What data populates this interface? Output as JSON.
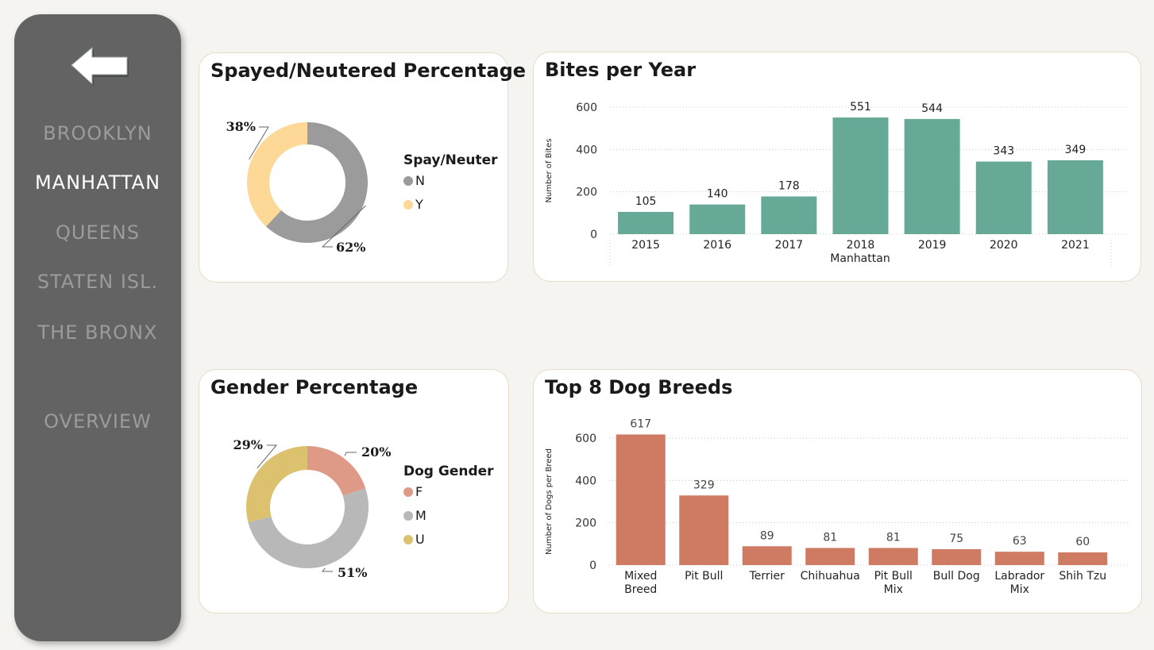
{
  "nav": {
    "items": [
      {
        "label": "BROOKLYN",
        "active": false
      },
      {
        "label": "MANHATTAN",
        "active": true
      },
      {
        "label": "QUEENS",
        "active": false
      },
      {
        "label": "STATEN ISL.",
        "active": false
      },
      {
        "label": "THE BRONX",
        "active": false
      },
      {
        "label": "OVERVIEW",
        "active": false
      }
    ]
  },
  "colors": {
    "sidebar": "#636363",
    "teal_bar": "#67a997",
    "salmon_bar": "#cf7b63",
    "spay_n": "#9b9b9b",
    "spay_y": "#fdd896",
    "gender_f": "#de9a86",
    "gender_m": "#b8b8b8",
    "gender_u": "#dcc16f"
  },
  "chart_data": [
    {
      "type": "pie",
      "title": "Spayed/Neutered Percentage",
      "legend_title": "Spay/Neuter",
      "legend_position": "right",
      "categories": [
        "N",
        "Y"
      ],
      "values": [
        62,
        38
      ],
      "labels": [
        "62%",
        "38%"
      ],
      "colors": [
        "#9b9b9b",
        "#fdd896"
      ]
    },
    {
      "type": "bar",
      "title": "Bites per Year",
      "xlabel": "Manhattan",
      "ylabel": "Number of Bites",
      "categories": [
        "2015",
        "2016",
        "2017",
        "2018",
        "2019",
        "2020",
        "2021"
      ],
      "values": [
        105,
        140,
        178,
        551,
        544,
        343,
        349
      ],
      "ylim": [
        0,
        600
      ],
      "yticks": [
        "0",
        "200",
        "400",
        "600"
      ],
      "grid": true,
      "color": "#67a997"
    },
    {
      "type": "pie",
      "title": "Gender Percentage",
      "legend_title": "Dog Gender",
      "legend_position": "right",
      "categories": [
        "F",
        "M",
        "U"
      ],
      "values": [
        20,
        51,
        29
      ],
      "labels": [
        "20%",
        "51%",
        "29%"
      ],
      "colors": [
        "#de9a86",
        "#b8b8b8",
        "#dcc16f"
      ]
    },
    {
      "type": "bar",
      "title": "Top 8 Dog Breeds",
      "xlabel": "",
      "ylabel": "Number of Dogs per Breed",
      "categories": [
        [
          "Mixed",
          "Breed"
        ],
        [
          "Pit Bull"
        ],
        [
          "Terrier"
        ],
        [
          "Chihuahua"
        ],
        [
          "Pit Bull",
          "Mix"
        ],
        [
          "Bull Dog"
        ],
        [
          "Labrador",
          "Mix"
        ],
        [
          "Shih Tzu"
        ]
      ],
      "values": [
        617,
        329,
        89,
        81,
        81,
        75,
        63,
        60
      ],
      "ylim": [
        0,
        600
      ],
      "yticks": [
        "0",
        "200",
        "400",
        "600"
      ],
      "grid": true,
      "color": "#cf7b63"
    }
  ]
}
